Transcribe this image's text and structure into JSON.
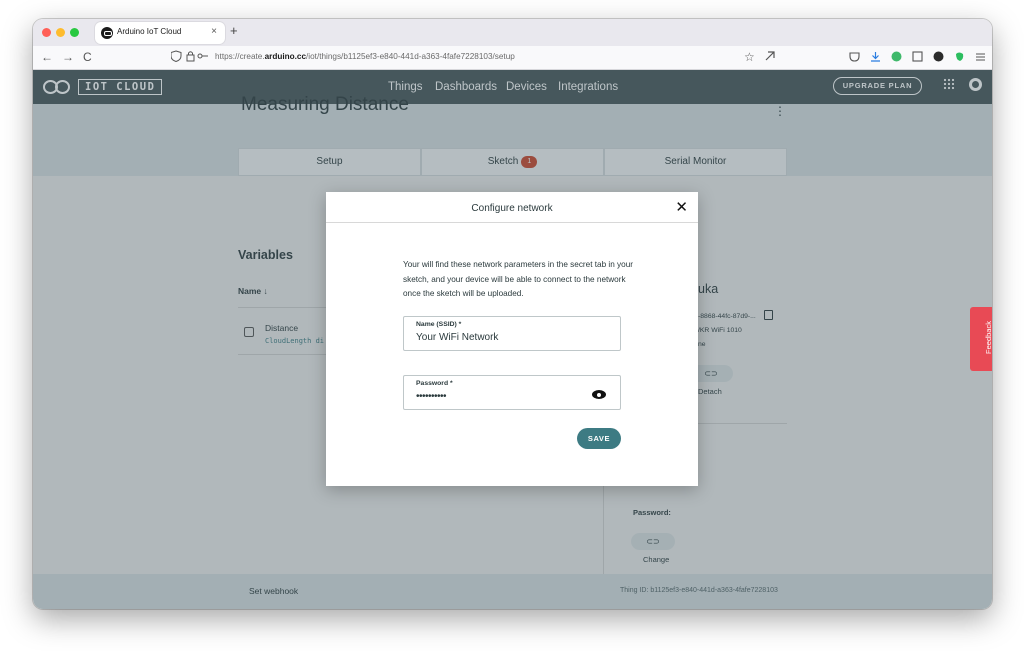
{
  "browser": {
    "tab_title": "Arduino IoT Cloud",
    "tab_close": "×",
    "new_tab": "+",
    "url_prefix": "https://create.",
    "url_domain": "arduino.cc",
    "url_path": "/iot/things/b1125ef3-e840-441d-a363-4fafe7228103/setup",
    "back": "←",
    "forward": "→",
    "reload": "C",
    "bookmark": "☆"
  },
  "header": {
    "logo_text": "IOT CLOUD",
    "nav": [
      "Things",
      "Dashboards",
      "Devices",
      "Integrations"
    ],
    "upgrade_label": "UPGRADE PLAN",
    "apps_glyph": "⋮⋮⋮"
  },
  "thing": {
    "title": "Measuring Distance",
    "menu_glyph": "⋮",
    "tabs": {
      "setup": "Setup",
      "sketch": "Sketch",
      "sketch_badge": "1",
      "serial": "Serial Monitor"
    }
  },
  "variables": {
    "title": "Variables",
    "column_name": "Name ↓",
    "rows": [
      {
        "name": "Distance",
        "type": "CloudLength di"
      }
    ]
  },
  "device": {
    "name_partial": "uka",
    "id_partial": "-8868-44fc-87d9-...",
    "type_partial": "/KR WiFi 1010",
    "status_partial": "ne",
    "detach_icon": "⊂⊃",
    "detach_label": "Detach",
    "password_label": "Password:",
    "change_icon": "⊂⊃",
    "change_label": "Change"
  },
  "footer": {
    "webhook": "Set webhook",
    "thing_id": "Thing ID: b1125ef3-e840-441d-a363-4fafe7228103"
  },
  "feedback_label": "Feedback",
  "modal": {
    "title": "Configure network",
    "close": "✕",
    "description": "Your will find these network parameters in the secret tab in your sketch, and your device will be able to connect to the network once the sketch will be uploaded.",
    "ssid_label": "Name (SSID) *",
    "ssid_value": "Your WiFi Network",
    "password_label": "Password *",
    "password_value": "••••••••••",
    "save_label": "SAVE"
  },
  "colors": {
    "header_bg": "#47565a",
    "accent": "#3d7b83",
    "badge": "#c9462c",
    "feedback": "#e84a55"
  }
}
